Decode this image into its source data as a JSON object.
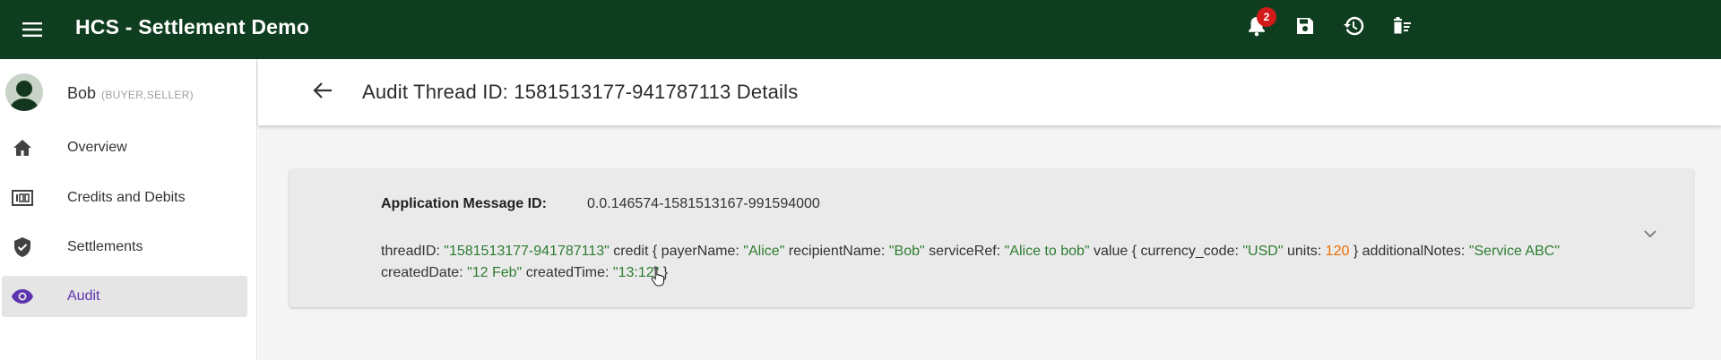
{
  "app": {
    "title": "HCS - Settlement Demo",
    "notifications_count": "2",
    "colors": {
      "appbar": "#0f3d1f",
      "active_nav": "#5e35b1",
      "string_value": "#2e7d32",
      "number_value": "#ef6c00",
      "badge": "#d11a1a"
    },
    "icons": [
      "menu-icon",
      "bell-icon",
      "save-icon",
      "history-icon",
      "delete-sweep-icon"
    ]
  },
  "user": {
    "name": "Bob",
    "roles": "(BUYER,SELLER)"
  },
  "sidebar": {
    "items": [
      {
        "label": "Overview",
        "icon": "home-icon"
      },
      {
        "label": "Credits and Debits",
        "icon": "ledger-icon"
      },
      {
        "label": "Settlements",
        "icon": "shield-icon"
      },
      {
        "label": "Audit",
        "icon": "eye-icon",
        "active": true
      }
    ]
  },
  "page": {
    "title": "Audit Thread ID: 1581513177-941787113 Details"
  },
  "message": {
    "id_label": "Application Message ID:",
    "id_value": "0.0.146574-1581513167-991594000",
    "payload": {
      "k_threadID": "threadID:",
      "threadID": "\"1581513177-941787113\"",
      "k_credit_open": "credit {",
      "k_payerName": "payerName:",
      "payerName": "\"Alice\"",
      "k_recipientName": "recipientName:",
      "recipientName": "\"Bob\"",
      "k_serviceRef": "serviceRef:",
      "serviceRef": "\"Alice to bob\"",
      "k_value_open": "value {",
      "k_currency_code": "currency_code:",
      "currency_code": "\"USD\"",
      "k_units": "units:",
      "units": "120",
      "k_close1": "}",
      "k_additionalNotes": "additionalNotes:",
      "additionalNotes": "\"Service ABC\"",
      "k_createdDate": "createdDate:",
      "createdDate": "\"12 Feb\"",
      "k_createdTime": "createdTime:",
      "createdTime": "\"13:12\"",
      "k_close2": "}"
    }
  }
}
